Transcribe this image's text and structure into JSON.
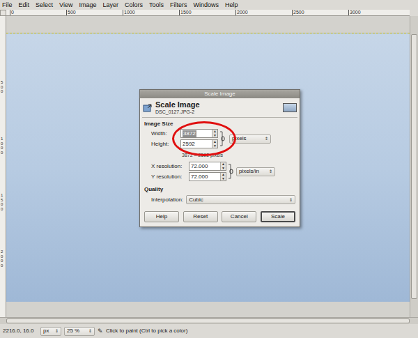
{
  "window": {
    "menu": [
      "File",
      "Edit",
      "Select",
      "View",
      "Image",
      "Layer",
      "Colors",
      "Tools",
      "Filters",
      "Windows",
      "Help"
    ]
  },
  "rulers": {
    "top": [
      "0",
      "500",
      "1000",
      "1500",
      "2000",
      "2500",
      "3000"
    ],
    "left": [
      "500",
      "1000",
      "1500",
      "2000"
    ]
  },
  "dialog": {
    "title": "Scale Image",
    "heading": "Scale Image",
    "subtitle": "DSC_0127.JPG-2",
    "image_size": {
      "label": "Image Size",
      "width": {
        "label": "Width:",
        "value": "3872",
        "selected": true
      },
      "height": {
        "label": "Height:",
        "value": "2592",
        "selected": false
      },
      "chain_linked": true,
      "unit": "pixels",
      "note": "3872 × 2592 pixels",
      "x_resolution": {
        "label": "X resolution:",
        "value": "72.000"
      },
      "y_resolution": {
        "label": "Y resolution:",
        "value": "72.000"
      },
      "resolution_unit": "pixels/in"
    },
    "quality": {
      "label": "Quality",
      "interpolation_label": "Interpolation:",
      "interpolation": "Cubic"
    },
    "buttons": [
      {
        "label": "Help",
        "selected": false
      },
      {
        "label": "Reset",
        "selected": false
      },
      {
        "label": "Cancel",
        "selected": false
      },
      {
        "label": "Scale",
        "selected": true
      }
    ]
  },
  "status_bar": {
    "coords": "2216.0, 16.0",
    "unit": "px",
    "zoom": "25 %",
    "message": "Click to paint (Ctrl to pick a color)"
  }
}
